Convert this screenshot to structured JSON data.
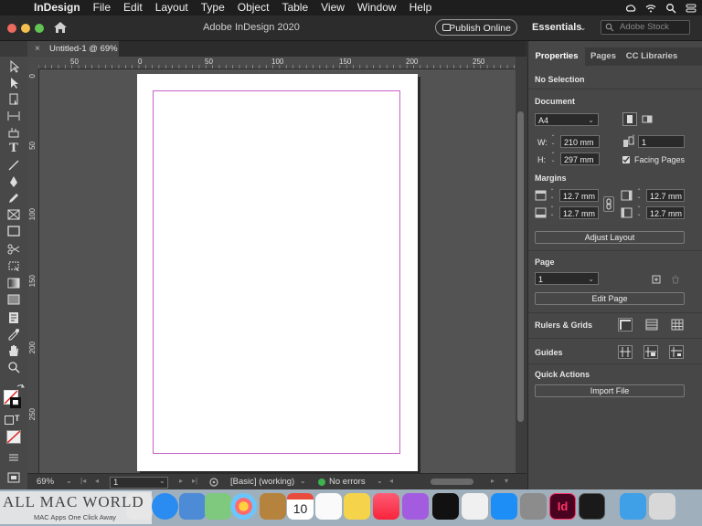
{
  "menubar": {
    "apple_glyph": "",
    "items": [
      "InDesign",
      "File",
      "Edit",
      "Layout",
      "Type",
      "Object",
      "Table",
      "View",
      "Window",
      "Help"
    ]
  },
  "appbar": {
    "title": "Adobe InDesign 2020",
    "publish_label": "Publish Online",
    "workspace_label": "Essentials",
    "workspace_chevron": "⌄",
    "search_placeholder": "Adobe Stock",
    "traffic_lights": [
      "#ed6a5e",
      "#f4bf4f",
      "#61c554"
    ]
  },
  "document": {
    "tab_label": "Untitled-1 @ 69%",
    "close_glyph": "×"
  },
  "rulers": {
    "horizontal_labels": [
      "50",
      "0",
      "50",
      "100",
      "150",
      "200",
      "250"
    ],
    "vertical_labels": [
      "0",
      "50",
      "100",
      "150",
      "200",
      "250"
    ]
  },
  "statusbar": {
    "zoom": "69%",
    "page": "1",
    "style": "[Basic] (working)",
    "errors": "No errors"
  },
  "properties": {
    "tabs": [
      "Properties",
      "Pages",
      "CC Libraries"
    ],
    "selection": "No Selection",
    "document_heading": "Document",
    "page_size": "A4",
    "width_label": "W:",
    "width": "210 mm",
    "height_label": "H:",
    "height": "297 mm",
    "pages_count": "1",
    "facing_pages": "Facing Pages",
    "margins_heading": "Margins",
    "margin_top": "12.7 mm",
    "margin_bottom": "12.7 mm",
    "margin_left": "12.7 mm",
    "margin_right": "12.7 mm",
    "adjust_layout": "Adjust Layout",
    "page_heading": "Page",
    "page_value": "1",
    "edit_page": "Edit Page",
    "rulers_grids": "Rulers & Grids",
    "guides": "Guides",
    "quick_actions": "Quick Actions",
    "import_file": "Import File"
  },
  "watermark": {
    "title": "ALL MAC WORLD",
    "subtitle": "MAC Apps One Click Away"
  },
  "dock": {
    "calendar_day": "10"
  }
}
